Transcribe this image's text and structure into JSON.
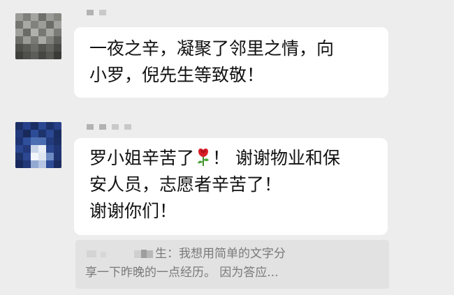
{
  "messages": [
    {
      "lines": [
        "一夜之辛，凝聚了邻里之情，向",
        "小罗，倪先生等致敬！"
      ]
    },
    {
      "line1_before": "罗小姐辛苦了",
      "line1_after": "！ 谢谢物业和保",
      "line2": "安人员，志愿者辛苦了！",
      "line3": "谢谢你们！",
      "emoji": "rose-emoji"
    }
  ],
  "quote": {
    "line1_text": "生：我想用简单的文字分",
    "line2_text": "享一下昨晚的一点经历。 因为答应..."
  },
  "colors": {
    "background": "#ededed",
    "bubble": "#ffffff",
    "quote_bg": "#e2e2e2",
    "quote_text": "#7a7a7a",
    "text": "#111111"
  }
}
